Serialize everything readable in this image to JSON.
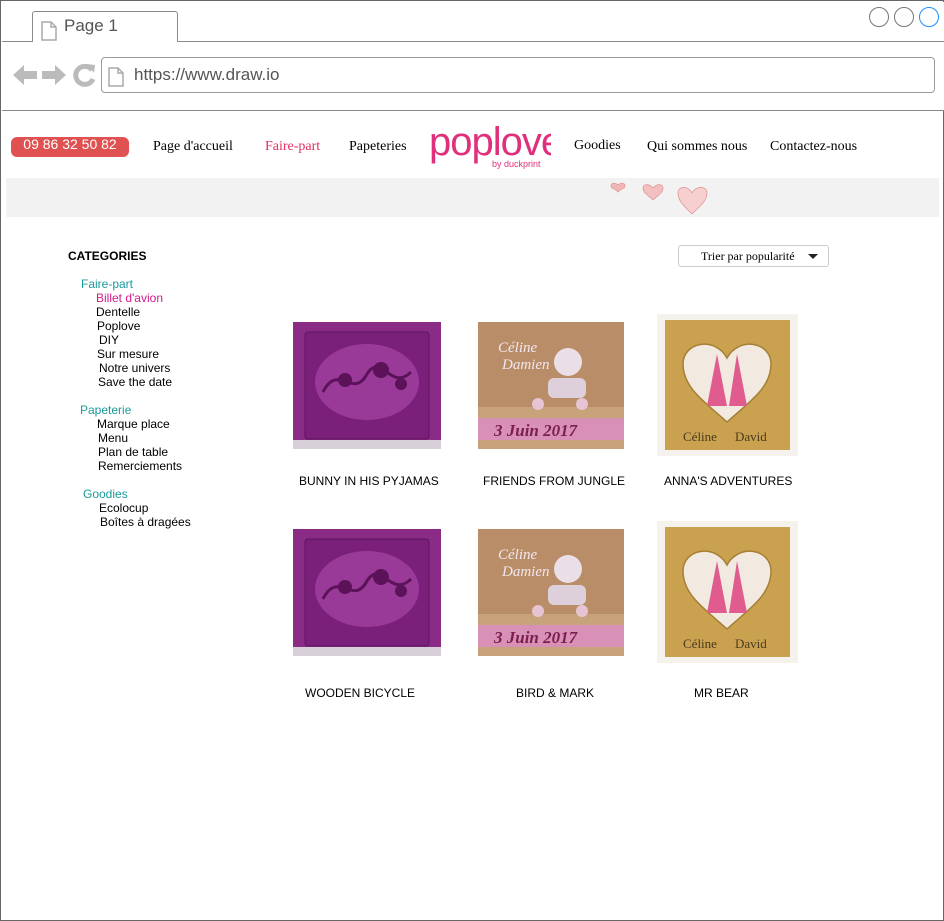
{
  "browser": {
    "tab_title": "Page 1",
    "url": "https://www.draw.io"
  },
  "header": {
    "phone": "09 86 32 50 82",
    "menu": [
      "Page d'accueil",
      "Faire-part",
      "Papeteries",
      "Goodies",
      "Qui sommes nous",
      "Contactez-nous"
    ],
    "active_menu": "Faire-part",
    "logo_text": "poplove",
    "logo_subtext": "by duckprint",
    "brand_color": "#e0307c"
  },
  "sidebar": {
    "title": "CATEGORIES",
    "groups": [
      {
        "label": "Faire-part",
        "items": [
          "Billet d'avion",
          "Dentelle",
          "Poplove",
          "DIY",
          "Sur mesure",
          "Notre univers",
          "Save the date"
        ]
      },
      {
        "label": "Papeterie",
        "items": [
          "Marque place",
          "Menu",
          "Plan de table",
          "Remerciements"
        ]
      },
      {
        "label": "Goodies",
        "items": [
          "Ecolocup",
          "Boîtes à dragées"
        ]
      }
    ],
    "current_item": "Billet d'avion"
  },
  "sort": {
    "label": "Trier par popularité"
  },
  "products": [
    {
      "name": "BUNNY IN HIS PYJAMAS",
      "image": "purple-floral-card"
    },
    {
      "name": "FRIENDS FROM JUNGLE",
      "image": "scooter-couple-card",
      "card_text": [
        "Céline",
        "Damien",
        "3 Juin 2017"
      ]
    },
    {
      "name": "ANNA'S ADVENTURES",
      "image": "heart-window-card",
      "card_text": [
        "Céline",
        "David"
      ]
    },
    {
      "name": "WOODEN BICYCLE",
      "image": "purple-floral-card"
    },
    {
      "name": "BIRD & MARK",
      "image": "scooter-couple-card",
      "card_text": [
        "Céline",
        "Damien",
        "3 Juin 2017"
      ]
    },
    {
      "name": "MR BEAR",
      "image": "heart-window-card",
      "card_text": [
        "Céline",
        "David"
      ]
    }
  ]
}
